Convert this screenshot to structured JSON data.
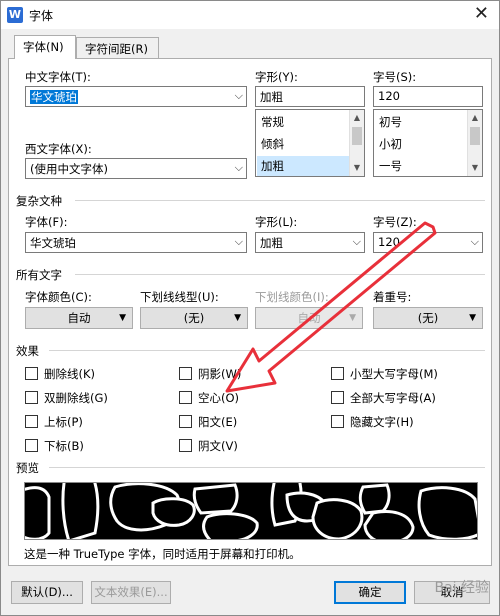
{
  "window": {
    "title": "字体",
    "close_glyph": "✕"
  },
  "tabs": [
    {
      "label": "字体(N)",
      "active": true
    },
    {
      "label": "字符间距(R)",
      "active": false
    }
  ],
  "chinese_font": {
    "label": "中文字体(T):",
    "value": "华文琥珀"
  },
  "western_font": {
    "label": "西文字体(X):",
    "value": "(使用中文字体)"
  },
  "style": {
    "label": "字形(Y):",
    "value": "加粗",
    "options": [
      "常规",
      "倾斜",
      "加粗"
    ],
    "selected": "加粗"
  },
  "size": {
    "label": "字号(S):",
    "value": "120",
    "options": [
      "初号",
      "小初",
      "一号"
    ]
  },
  "complex": {
    "section": "复杂文种",
    "font_label": "字体(F):",
    "font_value": "华文琥珀",
    "style_label": "字形(L):",
    "style_value": "加粗",
    "size_label": "字号(Z):",
    "size_value": "120"
  },
  "all_text": {
    "section": "所有文字",
    "color_label": "字体颜色(C):",
    "color_value": "自动",
    "underline_label": "下划线线型(U):",
    "underline_value": "(无)",
    "underline_color_label": "下划线颜色(I):",
    "underline_color_value": "自动",
    "emphasis_label": "着重号:",
    "emphasis_value": "(无)"
  },
  "effects": {
    "section": "效果",
    "col1": [
      "删除线(K)",
      "双删除线(G)",
      "上标(P)",
      "下标(B)"
    ],
    "col2": [
      "阴影(W)",
      "空心(O)",
      "阳文(E)",
      "阴文(V)"
    ],
    "col3": [
      "小型大写字母(M)",
      "全部大写字母(A)",
      "隐藏文字(H)"
    ]
  },
  "preview": {
    "section": "预览",
    "description": "这是一种 TrueType 字体，同时适用于屏幕和打印机。"
  },
  "buttons": {
    "default": "默认(D)...",
    "text_effect": "文本效果(E)...",
    "ok": "确定",
    "cancel": "取消"
  },
  "watermark": "Bai 经验",
  "colors": {
    "selection": "#0078d7",
    "arrow_annotation": "#e8303a"
  }
}
